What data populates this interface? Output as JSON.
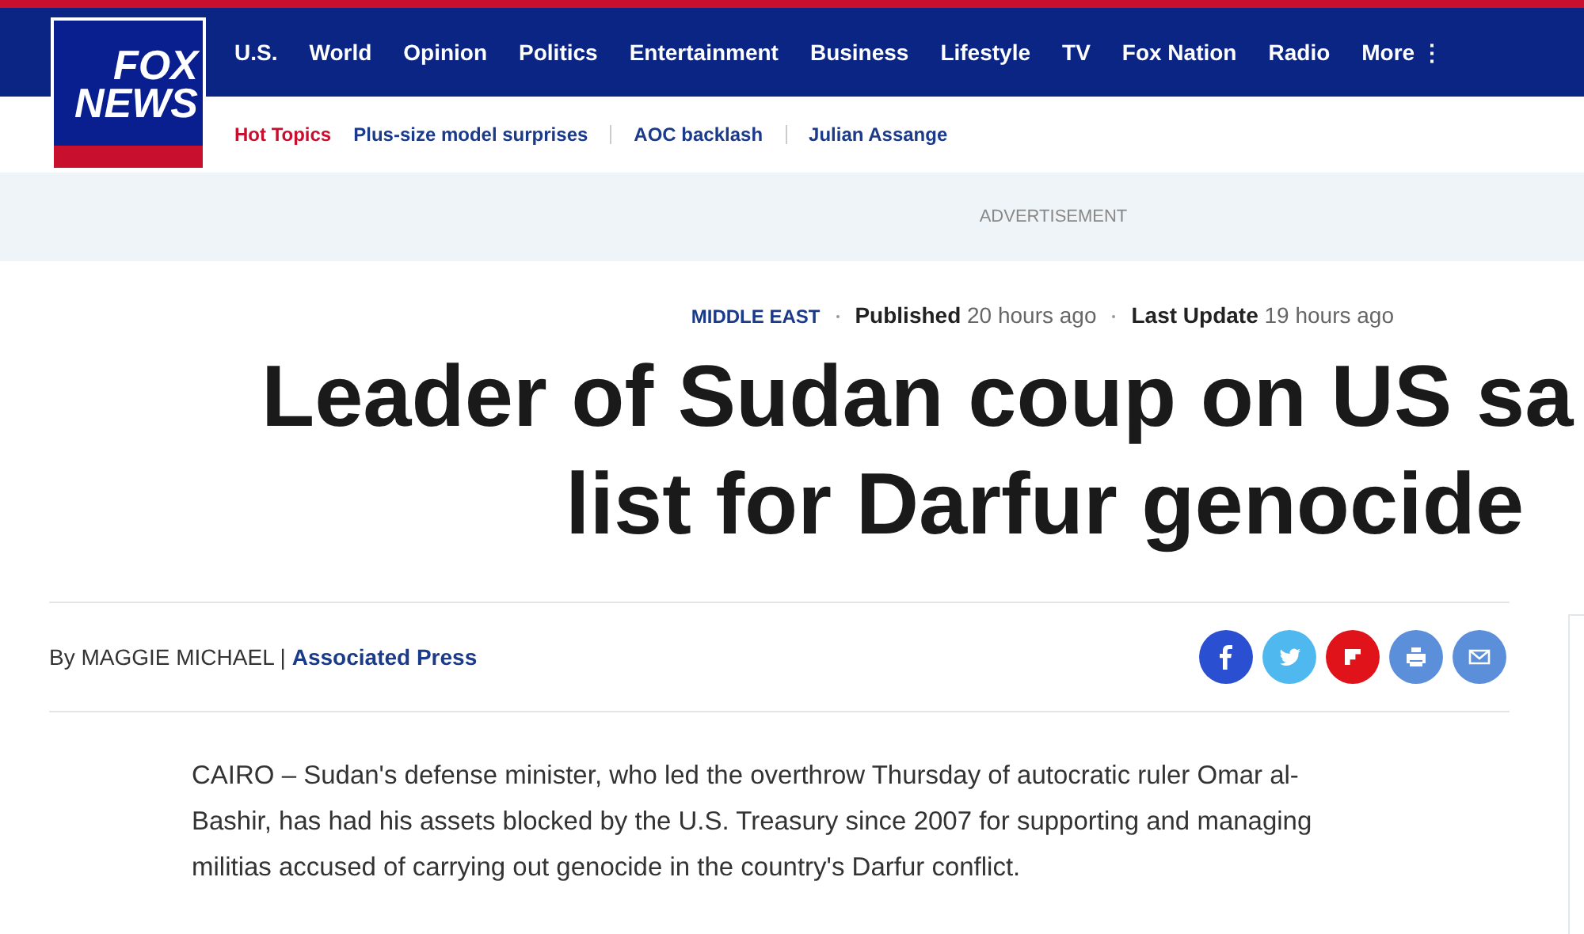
{
  "logo": {
    "line_1": "FOX",
    "line_2": "NEWS"
  },
  "nav": {
    "items": [
      "U.S.",
      "World",
      "Opinion",
      "Politics",
      "Entertainment",
      "Business",
      "Lifestyle",
      "TV",
      "Fox Nation",
      "Radio"
    ],
    "more": "More",
    "more_icon": "⋮"
  },
  "hot_topics": {
    "label": "Hot Topics",
    "items": [
      "Plus-size model surprises",
      "AOC backlash",
      "Julian Assange"
    ]
  },
  "advertisement": "ADVERTISEMENT",
  "article": {
    "category": "MIDDLE EAST",
    "published_label": "Published",
    "published": "20 hours ago",
    "updated_label": "Last Update",
    "updated": "19 hours ago",
    "headline_lines": [
      "Leader of Sudan coup on US sa",
      "list for Darfur genocide"
    ],
    "byline": "By MAGGIE MICHAEL |",
    "source": "Associated Press",
    "share_buttons": [
      {
        "kind": "facebook",
        "color": "#2b4fd1"
      },
      {
        "kind": "twitter",
        "color": "#4fb8ef"
      },
      {
        "kind": "flipboard",
        "color": "#e1131a"
      },
      {
        "kind": "print",
        "color": "#5b8fd9"
      },
      {
        "kind": "email",
        "color": "#5b8fd9"
      }
    ],
    "body": "CAIRO – Sudan's defense minister, who led the overthrow Thursday of autocratic ruler Omar al-Bashir, has had his assets blocked by the U.S. Treasury since 2007 for supporting and managing militias accused of carrying out genocide in the country's Darfur conflict."
  }
}
